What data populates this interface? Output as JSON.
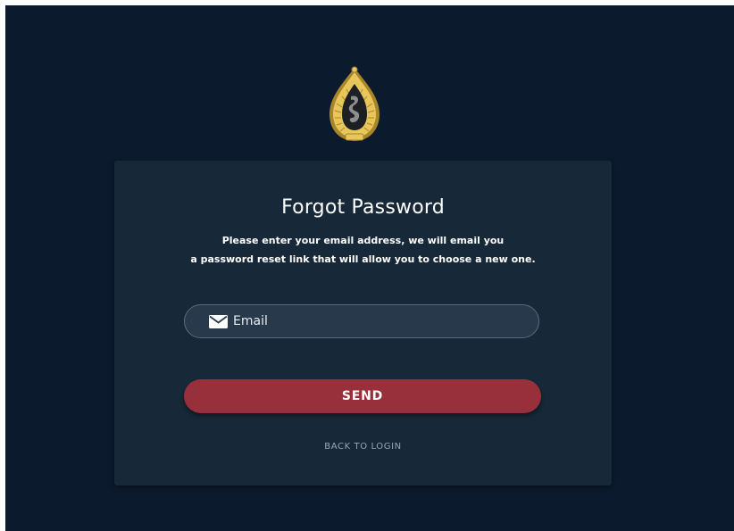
{
  "logo": {
    "icon": "royal-emblem-icon",
    "colors": {
      "gold": "#e7c65a",
      "gold_dark": "#a8842a",
      "inner": "#8d8d8d"
    }
  },
  "form": {
    "title": "Forgot Password",
    "description_line1": "Please enter your email address, we will email you",
    "description_line2": "a password reset link that will allow you to choose a new one.",
    "email": {
      "icon": "envelope-icon",
      "placeholder": "Email",
      "value": ""
    },
    "send_label": "SEND",
    "back_label": "BACK TO LOGIN"
  },
  "colors": {
    "background": "#0b1b2d",
    "card": "#172838",
    "input_bg": "#27394a",
    "accent": "#97303a",
    "muted_text": "#9aa6b2"
  }
}
